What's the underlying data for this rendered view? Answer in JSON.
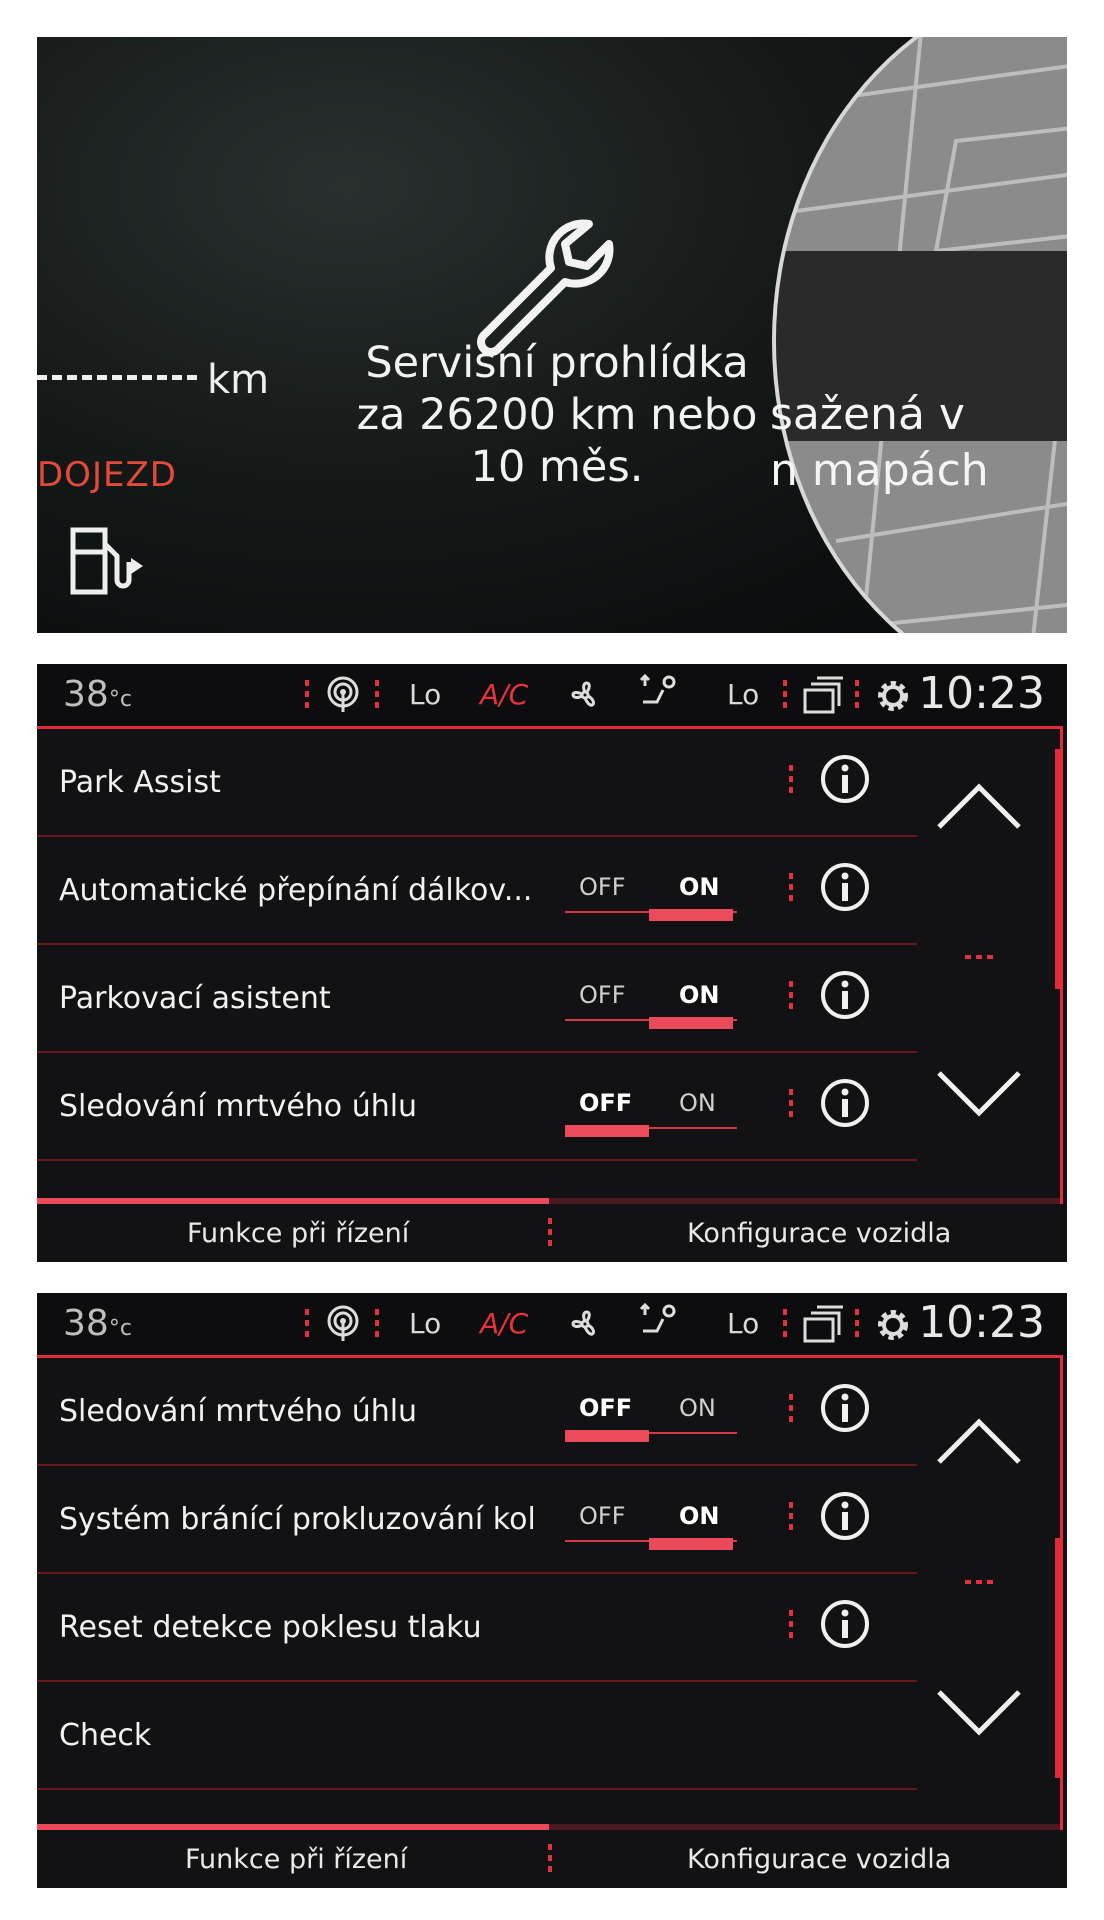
{
  "cluster": {
    "service_line1": "Servisní prohlídka",
    "service_line2": "za 26200 km nebo",
    "service_line3": "10 měs.",
    "range_unit": "km",
    "range_label": "DOJEZD",
    "map_text_line1": "sažená v",
    "map_text_line2": "n mapách",
    "icons": [
      "wrench-icon",
      "fuel-pump-icon"
    ]
  },
  "statusbar": {
    "temperature": "38",
    "temperature_unit": "°c",
    "fan_left": "Lo",
    "ac_label": "A/C",
    "fan_right": "Lo",
    "time": "10:23"
  },
  "screen1": {
    "rows": [
      {
        "label": "Park Assist"
      },
      {
        "label": "Automatické přepínání dálkov...",
        "off": "OFF",
        "on": "ON",
        "state": "ON"
      },
      {
        "label": "Parkovací asistent",
        "off": "OFF",
        "on": "ON",
        "state": "ON"
      },
      {
        "label": "Sledování mrtvého úhlu",
        "off": "OFF",
        "on": "ON",
        "state": "OFF"
      }
    ],
    "tabs": [
      "Funkce při řízení",
      "Konfigurace vozidla"
    ]
  },
  "screen2": {
    "rows": [
      {
        "label": "Sledování mrtvého úhlu",
        "off": "OFF",
        "on": "ON",
        "state": "OFF"
      },
      {
        "label": "Systém bránící prokluzování kol",
        "off": "OFF",
        "on": "ON",
        "state": "ON"
      },
      {
        "label": "Reset detekce poklesu tlaku"
      },
      {
        "label": "Check"
      }
    ],
    "tabs": [
      "Funkce při řízení",
      "Konfigurace vozidla"
    ]
  },
  "colors": {
    "accent": "#e22b3a",
    "toggle_bar": "#ea4a5a",
    "range_label": "#e24b3a"
  }
}
